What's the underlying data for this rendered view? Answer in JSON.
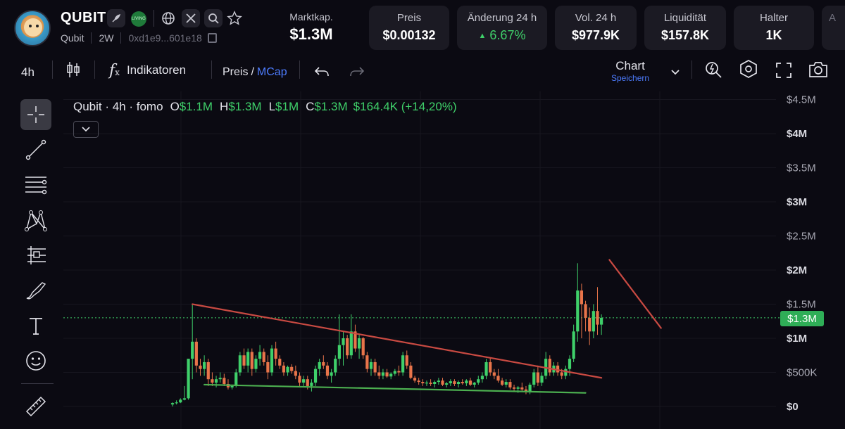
{
  "token": {
    "symbol": "QUBIT",
    "name": "Qubit",
    "age": "2W",
    "address": "0xd1e9...601e18",
    "live_badge": "LIVING"
  },
  "header_icons": [
    "feather-icon",
    "live-badge-icon",
    "globe-icon",
    "x-icon",
    "search-icon",
    "star-icon",
    "copy-icon"
  ],
  "market_cap": {
    "label": "Marktkap.",
    "value": "$1.3M"
  },
  "stats": [
    {
      "label": "Preis",
      "value": "$0.00132"
    },
    {
      "label": "Änderung 24 h",
      "value": "6.67%",
      "direction": "up"
    },
    {
      "label": "Vol. 24 h",
      "value": "$977.9K"
    },
    {
      "label": "Liquidität",
      "value": "$157.8K"
    },
    {
      "label": "Halter",
      "value": "1K"
    },
    {
      "label": "A",
      "value": ""
    }
  ],
  "toolbar": {
    "interval": "4h",
    "indicators": "Indikatoren",
    "price_toggle": "Preis",
    "price_sep": "/",
    "mcap_toggle": "MCap",
    "chart_label": "Chart",
    "save_label": "Speichern"
  },
  "legend": {
    "title": "Qubit · 4h · fomo",
    "o_label": "O",
    "o_value": "$1.1M",
    "h_label": "H",
    "h_value": "$1.3M",
    "l_label": "L",
    "l_value": "$1M",
    "c_label": "C",
    "c_value": "$1.3M",
    "change": "$164.4K (+14,20%)"
  },
  "current_price_tag": "$1.3M",
  "colors": {
    "up": "#3fd06a",
    "down": "#e8744a",
    "trendline_red": "#c94a42",
    "trendline_green": "#4caf50",
    "accent_blue": "#4d7cfe",
    "background": "#0b0a12"
  },
  "chart_data": {
    "type": "candlestick",
    "y_axis": {
      "ticks": [
        {
          "label": "$4.5M",
          "value": 4500000
        },
        {
          "label": "$4M",
          "value": 4000000,
          "bold": true
        },
        {
          "label": "$3.5M",
          "value": 3500000
        },
        {
          "label": "$3M",
          "value": 3000000,
          "bold": true
        },
        {
          "label": "$2.5M",
          "value": 2500000
        },
        {
          "label": "$2M",
          "value": 2000000,
          "bold": true
        },
        {
          "label": "$1.5M",
          "value": 1500000
        },
        {
          "label": "$1M",
          "value": 1000000,
          "bold": true
        },
        {
          "label": "$500K",
          "value": 500000
        },
        {
          "label": "$0",
          "value": 0,
          "bold": true
        }
      ],
      "range": [
        0,
        4600000
      ]
    },
    "current_value": 1300000,
    "candles": [
      [
        0.03,
        0.06,
        0.0,
        0.05
      ],
      [
        0.05,
        0.09,
        0.03,
        0.06
      ],
      [
        0.06,
        0.12,
        0.05,
        0.1
      ],
      [
        0.1,
        0.3,
        0.09,
        0.12
      ],
      [
        0.12,
        0.55,
        0.1,
        0.7
      ],
      [
        0.7,
        1.5,
        0.4,
        0.95
      ],
      [
        0.95,
        1.0,
        0.5,
        0.6
      ],
      [
        0.6,
        0.7,
        0.45,
        0.55
      ],
      [
        0.55,
        0.75,
        0.45,
        0.65
      ],
      [
        0.65,
        0.7,
        0.3,
        0.4
      ],
      [
        0.4,
        0.5,
        0.3,
        0.35
      ],
      [
        0.35,
        0.45,
        0.28,
        0.4
      ],
      [
        0.4,
        0.5,
        0.35,
        0.42
      ],
      [
        0.42,
        0.48,
        0.3,
        0.33
      ],
      [
        0.33,
        0.4,
        0.25,
        0.28
      ],
      [
        0.28,
        0.32,
        0.25,
        0.3
      ],
      [
        0.3,
        0.55,
        0.28,
        0.5
      ],
      [
        0.5,
        0.8,
        0.45,
        0.75
      ],
      [
        0.75,
        0.85,
        0.55,
        0.6
      ],
      [
        0.6,
        0.85,
        0.5,
        0.8
      ],
      [
        0.8,
        0.85,
        0.45,
        0.55
      ],
      [
        0.55,
        0.75,
        0.5,
        0.7
      ],
      [
        0.7,
        0.9,
        0.6,
        0.8
      ],
      [
        0.8,
        0.85,
        0.6,
        0.65
      ],
      [
        0.65,
        0.75,
        0.4,
        0.5
      ],
      [
        0.5,
        0.9,
        0.45,
        0.85
      ],
      [
        0.85,
        0.95,
        0.6,
        0.7
      ],
      [
        0.7,
        0.75,
        0.55,
        0.6
      ],
      [
        0.6,
        0.65,
        0.45,
        0.5
      ],
      [
        0.5,
        0.6,
        0.45,
        0.58
      ],
      [
        0.58,
        0.62,
        0.48,
        0.52
      ],
      [
        0.52,
        0.6,
        0.4,
        0.45
      ],
      [
        0.45,
        0.5,
        0.3,
        0.35
      ],
      [
        0.35,
        0.45,
        0.3,
        0.4
      ],
      [
        0.4,
        0.45,
        0.25,
        0.3
      ],
      [
        0.3,
        0.4,
        0.22,
        0.35
      ],
      [
        0.35,
        0.6,
        0.3,
        0.55
      ],
      [
        0.55,
        0.7,
        0.45,
        0.65
      ],
      [
        0.65,
        0.75,
        0.55,
        0.6
      ],
      [
        0.6,
        0.65,
        0.4,
        0.45
      ],
      [
        0.45,
        0.55,
        0.35,
        0.5
      ],
      [
        0.5,
        0.75,
        0.45,
        0.7
      ],
      [
        0.7,
        1.35,
        0.6,
        0.9
      ],
      [
        0.9,
        1.1,
        0.6,
        1.0
      ],
      [
        1.0,
        1.05,
        0.7,
        0.75
      ],
      [
        0.75,
        1.35,
        0.7,
        1.1
      ],
      [
        1.1,
        1.2,
        0.8,
        0.85
      ],
      [
        0.85,
        1.05,
        0.7,
        1.0
      ],
      [
        1.0,
        1.02,
        0.7,
        0.75
      ],
      [
        0.75,
        0.8,
        0.5,
        0.55
      ],
      [
        0.55,
        0.7,
        0.45,
        0.65
      ],
      [
        0.65,
        0.7,
        0.45,
        0.5
      ],
      [
        0.5,
        0.6,
        0.4,
        0.45
      ],
      [
        0.45,
        0.55,
        0.4,
        0.5
      ],
      [
        0.5,
        0.55,
        0.42,
        0.44
      ],
      [
        0.44,
        0.5,
        0.4,
        0.48
      ],
      [
        0.48,
        0.55,
        0.45,
        0.52
      ],
      [
        0.52,
        0.6,
        0.45,
        0.5
      ],
      [
        0.5,
        0.8,
        0.45,
        0.75
      ],
      [
        0.75,
        0.82,
        0.55,
        0.6
      ],
      [
        0.6,
        0.65,
        0.4,
        0.42
      ],
      [
        0.42,
        0.45,
        0.35,
        0.38
      ],
      [
        0.38,
        0.42,
        0.32,
        0.36
      ],
      [
        0.36,
        0.4,
        0.3,
        0.34
      ],
      [
        0.34,
        0.38,
        0.3,
        0.35
      ],
      [
        0.35,
        0.4,
        0.3,
        0.33
      ],
      [
        0.33,
        0.38,
        0.28,
        0.36
      ],
      [
        0.36,
        0.42,
        0.32,
        0.38
      ],
      [
        0.38,
        0.42,
        0.3,
        0.32
      ],
      [
        0.32,
        0.36,
        0.28,
        0.34
      ],
      [
        0.34,
        0.4,
        0.3,
        0.37
      ],
      [
        0.37,
        0.4,
        0.3,
        0.33
      ],
      [
        0.33,
        0.38,
        0.28,
        0.36
      ],
      [
        0.36,
        0.4,
        0.32,
        0.34
      ],
      [
        0.34,
        0.4,
        0.3,
        0.38
      ],
      [
        0.38,
        0.42,
        0.3,
        0.32
      ],
      [
        0.32,
        0.36,
        0.28,
        0.35
      ],
      [
        0.35,
        0.45,
        0.32,
        0.4
      ],
      [
        0.4,
        0.5,
        0.35,
        0.45
      ],
      [
        0.45,
        0.7,
        0.4,
        0.65
      ],
      [
        0.65,
        0.72,
        0.45,
        0.5
      ],
      [
        0.5,
        0.55,
        0.4,
        0.45
      ],
      [
        0.45,
        0.55,
        0.35,
        0.38
      ],
      [
        0.38,
        0.42,
        0.3,
        0.32
      ],
      [
        0.32,
        0.4,
        0.28,
        0.36
      ],
      [
        0.36,
        0.4,
        0.25,
        0.28
      ],
      [
        0.28,
        0.32,
        0.22,
        0.26
      ],
      [
        0.26,
        0.3,
        0.2,
        0.28
      ],
      [
        0.28,
        0.35,
        0.22,
        0.25
      ],
      [
        0.25,
        0.3,
        0.18,
        0.22
      ],
      [
        0.22,
        0.35,
        0.18,
        0.32
      ],
      [
        0.32,
        0.55,
        0.28,
        0.5
      ],
      [
        0.5,
        0.6,
        0.3,
        0.35
      ],
      [
        0.35,
        0.5,
        0.3,
        0.45
      ],
      [
        0.45,
        0.8,
        0.4,
        0.7
      ],
      [
        0.7,
        0.75,
        0.45,
        0.5
      ],
      [
        0.5,
        0.65,
        0.45,
        0.6
      ],
      [
        0.6,
        0.65,
        0.45,
        0.5
      ],
      [
        0.5,
        0.55,
        0.4,
        0.45
      ],
      [
        0.45,
        0.6,
        0.4,
        0.55
      ],
      [
        0.55,
        0.75,
        0.45,
        0.7
      ],
      [
        0.7,
        1.2,
        0.65,
        1.1
      ],
      [
        1.1,
        2.1,
        0.95,
        1.7
      ],
      [
        1.7,
        1.8,
        1.0,
        1.5
      ],
      [
        1.5,
        1.55,
        1.1,
        1.3
      ],
      [
        1.3,
        1.45,
        0.9,
        1.1
      ],
      [
        1.1,
        1.5,
        1.0,
        1.4
      ],
      [
        1.4,
        1.75,
        1.05,
        1.2
      ],
      [
        1.2,
        1.35,
        1.05,
        1.3
      ]
    ],
    "trendlines": [
      {
        "color": "red",
        "from": [
          5,
          1.5
        ],
        "to": [
          108,
          0.42
        ]
      },
      {
        "color": "green",
        "from": [
          8,
          0.32
        ],
        "to": [
          104,
          0.2
        ]
      },
      {
        "color": "red",
        "from": [
          110,
          2.15
        ],
        "to": [
          123,
          1.15
        ]
      }
    ],
    "units": "candle values in millions USD (open, high, low, close)"
  }
}
